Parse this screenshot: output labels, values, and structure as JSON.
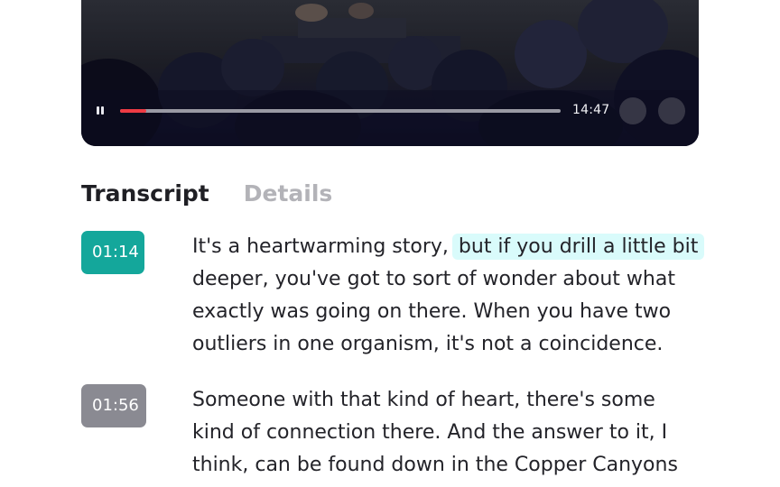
{
  "player": {
    "time": "14:47",
    "progress": 0.06,
    "progress_color": "#ef3b44",
    "pause_icon": "pause-icon"
  },
  "tabs": [
    {
      "label": "Transcript",
      "active": true
    },
    {
      "label": "Details",
      "active": false
    }
  ],
  "transcript": [
    {
      "timestamp": "01:14",
      "active": true,
      "text_before": "It's a heartwarming story, ",
      "highlight": "but if you drill a little bit",
      "line2": "deeper, you've got to sort of wonder about what",
      "line3": "exactly was going on there. When you have two",
      "line4": "outliers in one organism, it's not a coincidence."
    },
    {
      "timestamp": "01:56",
      "active": false,
      "line1": "Someone with that kind of heart, there's some",
      "line2": "kind of connection there. And the answer to it, I",
      "line3": "think, can be found down in the Copper Canyons"
    }
  ],
  "colors": {
    "accent": "#14a79b",
    "highlight": "#d9fbfb",
    "timestamp_inactive": "#8a8a92"
  }
}
